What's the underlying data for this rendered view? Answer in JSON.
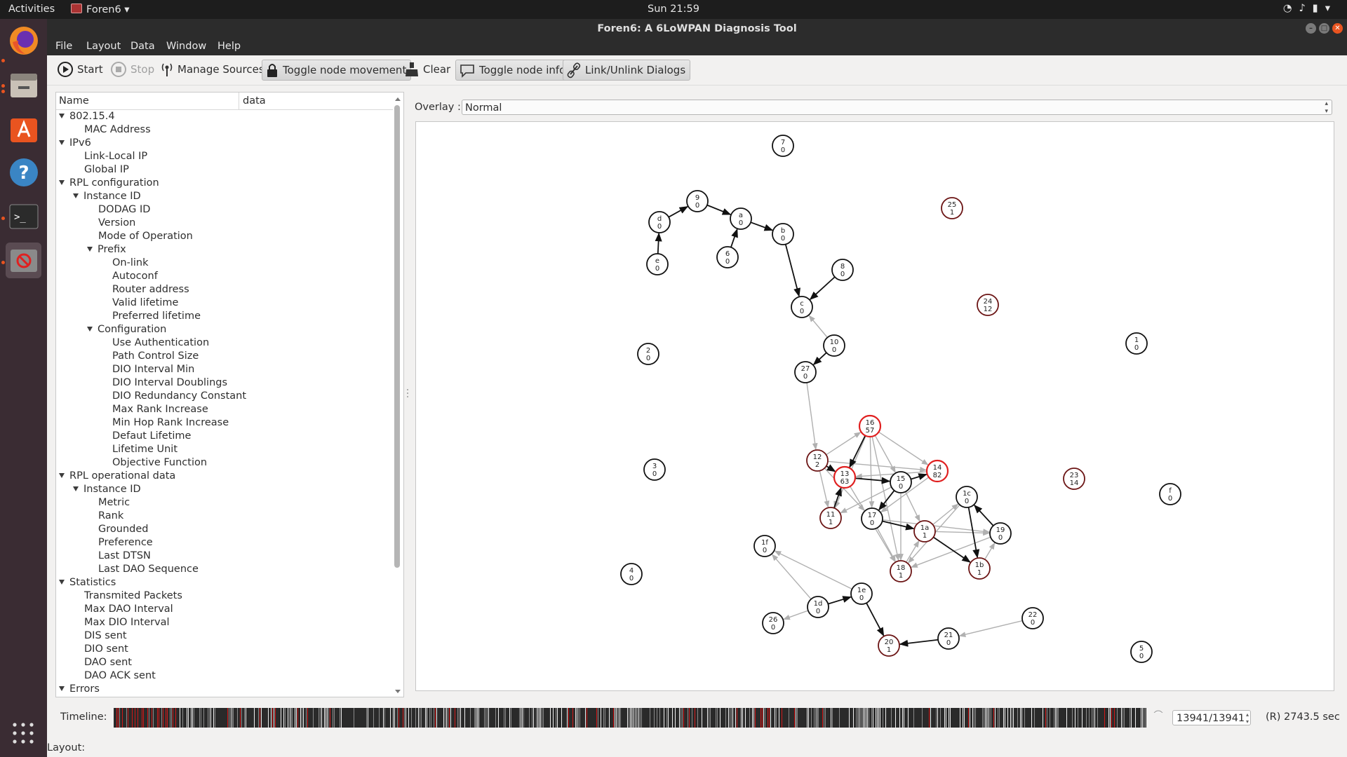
{
  "topbar": {
    "activities": "Activities",
    "app_name": "Foren6",
    "clock": "Sun 21:59"
  },
  "window": {
    "title": "Foren6: A 6LoWPAN Diagnosis Tool"
  },
  "menu": [
    "File",
    "Layout",
    "Data",
    "Window",
    "Help"
  ],
  "toolbar": {
    "start": "Start",
    "stop": "Stop",
    "manage_sources": "Manage Sources",
    "toggle_movement": "Toggle node movement",
    "clear": "Clear",
    "toggle_info": "Toggle node info",
    "link_dialogs": "Link/Unlink Dialogs"
  },
  "tree": {
    "col_name": "Name",
    "col_data": "data",
    "rows": [
      {
        "label": "802.15.4",
        "level": 0,
        "exp": true
      },
      {
        "label": "MAC Address",
        "level": 1,
        "exp": false
      },
      {
        "label": "IPv6",
        "level": 0,
        "exp": true
      },
      {
        "label": "Link-Local IP",
        "level": 1,
        "exp": false
      },
      {
        "label": "Global IP",
        "level": 1,
        "exp": false
      },
      {
        "label": "RPL configuration",
        "level": 0,
        "exp": true
      },
      {
        "label": "Instance ID",
        "level": 1,
        "exp": true
      },
      {
        "label": "DODAG ID",
        "level": 2,
        "exp": false
      },
      {
        "label": "Version",
        "level": 2,
        "exp": false
      },
      {
        "label": "Mode of Operation",
        "level": 2,
        "exp": false
      },
      {
        "label": "Prefix",
        "level": 2,
        "exp": true
      },
      {
        "label": "On-link",
        "level": 3,
        "exp": false
      },
      {
        "label": "Autoconf",
        "level": 3,
        "exp": false
      },
      {
        "label": "Router address",
        "level": 3,
        "exp": false
      },
      {
        "label": "Valid lifetime",
        "level": 3,
        "exp": false
      },
      {
        "label": "Preferred lifetime",
        "level": 3,
        "exp": false
      },
      {
        "label": "Configuration",
        "level": 2,
        "exp": true
      },
      {
        "label": "Use Authentication",
        "level": 3,
        "exp": false
      },
      {
        "label": "Path Control Size",
        "level": 3,
        "exp": false
      },
      {
        "label": "DIO Interval Min",
        "level": 3,
        "exp": false
      },
      {
        "label": "DIO Interval Doublings",
        "level": 3,
        "exp": false
      },
      {
        "label": "DIO Redundancy Constant",
        "level": 3,
        "exp": false
      },
      {
        "label": "Max Rank Increase",
        "level": 3,
        "exp": false
      },
      {
        "label": "Min Hop Rank Increase",
        "level": 3,
        "exp": false
      },
      {
        "label": "Defaut Lifetime",
        "level": 3,
        "exp": false
      },
      {
        "label": "Lifetime Unit",
        "level": 3,
        "exp": false
      },
      {
        "label": "Objective Function",
        "level": 3,
        "exp": false
      },
      {
        "label": "RPL operational data",
        "level": 0,
        "exp": true
      },
      {
        "label": "Instance ID",
        "level": 1,
        "exp": true
      },
      {
        "label": "Metric",
        "level": 2,
        "exp": false
      },
      {
        "label": "Rank",
        "level": 2,
        "exp": false
      },
      {
        "label": "Grounded",
        "level": 2,
        "exp": false
      },
      {
        "label": "Preference",
        "level": 2,
        "exp": false
      },
      {
        "label": "Last DTSN",
        "level": 2,
        "exp": false
      },
      {
        "label": "Last DAO Sequence",
        "level": 2,
        "exp": false
      },
      {
        "label": "Statistics",
        "level": 0,
        "exp": true
      },
      {
        "label": "Transmited Packets",
        "level": 1,
        "exp": false
      },
      {
        "label": "Max DAO Interval",
        "level": 1,
        "exp": false
      },
      {
        "label": "Max DIO Interval",
        "level": 1,
        "exp": false
      },
      {
        "label": "DIS sent",
        "level": 1,
        "exp": false
      },
      {
        "label": "DIO sent",
        "level": 1,
        "exp": false
      },
      {
        "label": "DAO sent",
        "level": 1,
        "exp": false
      },
      {
        "label": "DAO ACK sent",
        "level": 1,
        "exp": false
      },
      {
        "label": "Errors",
        "level": 0,
        "exp": true
      }
    ]
  },
  "overlay": {
    "label": "Overlay :",
    "value": "Normal"
  },
  "graph": {
    "nodes": [
      {
        "id": "7",
        "val": "0",
        "state": "normal"
      },
      {
        "id": "9",
        "val": "0",
        "state": "normal"
      },
      {
        "id": "a",
        "val": "0",
        "state": "normal"
      },
      {
        "id": "d",
        "val": "0",
        "state": "normal"
      },
      {
        "id": "b",
        "val": "0",
        "state": "normal"
      },
      {
        "id": "e",
        "val": "0",
        "state": "normal"
      },
      {
        "id": "6",
        "val": "0",
        "state": "normal"
      },
      {
        "id": "8",
        "val": "0",
        "state": "normal"
      },
      {
        "id": "c",
        "val": "0",
        "state": "normal"
      },
      {
        "id": "25",
        "val": "1",
        "state": "dark"
      },
      {
        "id": "24",
        "val": "12",
        "state": "dark"
      },
      {
        "id": "1",
        "val": "0",
        "state": "normal"
      },
      {
        "id": "2",
        "val": "0",
        "state": "normal"
      },
      {
        "id": "10",
        "val": "0",
        "state": "normal"
      },
      {
        "id": "27",
        "val": "0",
        "state": "normal"
      },
      {
        "id": "16",
        "val": "57",
        "state": "red"
      },
      {
        "id": "12",
        "val": "2",
        "state": "dark"
      },
      {
        "id": "14",
        "val": "82",
        "state": "red"
      },
      {
        "id": "13",
        "val": "63",
        "state": "red"
      },
      {
        "id": "15",
        "val": "0",
        "state": "normal"
      },
      {
        "id": "3",
        "val": "0",
        "state": "normal"
      },
      {
        "id": "23",
        "val": "14",
        "state": "dark"
      },
      {
        "id": "1c",
        "val": "0",
        "state": "normal"
      },
      {
        "id": "f",
        "val": "0",
        "state": "normal"
      },
      {
        "id": "11",
        "val": "1",
        "state": "dark"
      },
      {
        "id": "17",
        "val": "0",
        "state": "normal"
      },
      {
        "id": "1a",
        "val": "1",
        "state": "dark"
      },
      {
        "id": "19",
        "val": "0",
        "state": "normal"
      },
      {
        "id": "1f",
        "val": "0",
        "state": "normal"
      },
      {
        "id": "18",
        "val": "1",
        "state": "dark"
      },
      {
        "id": "1b",
        "val": "1",
        "state": "dark"
      },
      {
        "id": "4",
        "val": "0",
        "state": "normal"
      },
      {
        "id": "1e",
        "val": "0",
        "state": "normal"
      },
      {
        "id": "1d",
        "val": "0",
        "state": "normal"
      },
      {
        "id": "26",
        "val": "0",
        "state": "normal"
      },
      {
        "id": "22",
        "val": "0",
        "state": "normal"
      },
      {
        "id": "21",
        "val": "0",
        "state": "normal"
      },
      {
        "id": "20",
        "val": "1",
        "state": "dark"
      },
      {
        "id": "5",
        "val": "0",
        "state": "normal"
      }
    ],
    "colors": {
      "red": "#e02020",
      "dark": "#6b1414",
      "normal": "#111111",
      "edge_primary": "#111111",
      "edge_secondary": "#b0b0b0"
    }
  },
  "timeline": {
    "label": "Timeline:",
    "value": "13941/13941",
    "time": "(R) 2743.5  sec"
  },
  "status": {
    "text": "Layout:"
  }
}
